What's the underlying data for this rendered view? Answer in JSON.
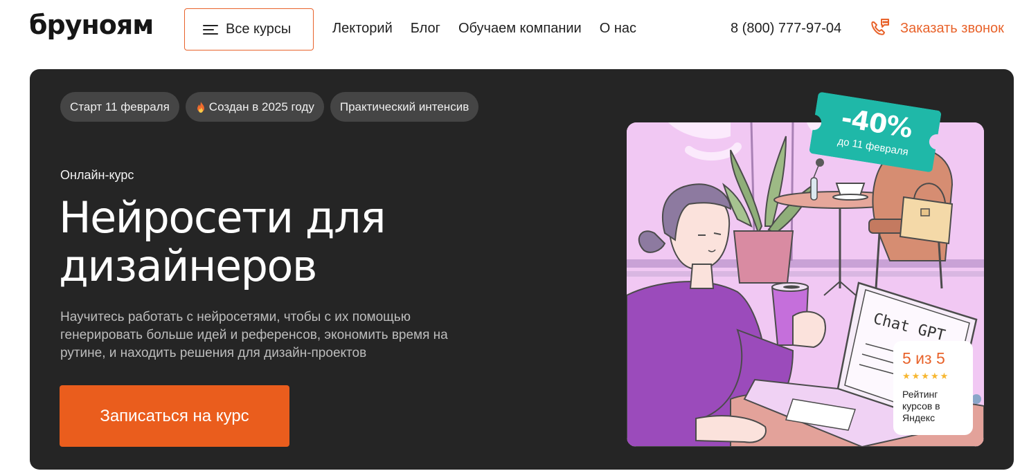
{
  "header": {
    "logo": "бруноям",
    "all_courses_label": "Все курсы",
    "nav": [
      "Лекторий",
      "Блог",
      "Обучаем компании",
      "О нас"
    ],
    "phone": "8 (800) 777-97-04",
    "callback_label": "Заказать звонок"
  },
  "hero": {
    "tags": [
      "Старт 11 февраля",
      "Создан в 2025 году",
      "Практический интенсив"
    ],
    "kicker": "Онлайн-курс",
    "title": "Нейросети для дизайнеров",
    "description": "Научитесь работать с нейросетями, чтобы с их помощью генерировать больше идей и референсов, экономить время на рутине, и находить решения для дизайн-проектов",
    "cta_label": "Записаться на курс",
    "discount": {
      "percent": "-40%",
      "until": "до 11 февраля"
    },
    "rating": {
      "score": "5 из 5",
      "stars": 5,
      "caption": "Рейтинг курсов в Яндекс"
    },
    "illustration_text": "Chat GPT"
  },
  "colors": {
    "accent": "#e8622a",
    "hero_bg": "#252525",
    "tag_bg": "#454545",
    "ticket": "#1fb8a8",
    "illustration_bg": "#f1c8f3"
  }
}
